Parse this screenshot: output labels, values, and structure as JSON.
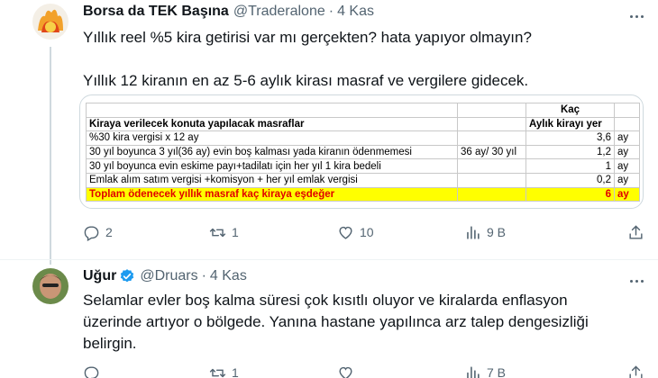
{
  "tweet1": {
    "display_name": "Borsa da TEK Başına",
    "handle": "@Traderalone",
    "dot": "·",
    "time": "4 Kas",
    "text_line1": "Yıllık reel %5 kira getirisi var mı gerçekten? hata yapıyor olmayın?",
    "text_line2": "Yıllık 12 kiranın en az 5-6 aylık kirası masraf ve vergilere gidecek.",
    "table": {
      "header_right_1": "Kaç",
      "header_left": "Kiraya verilecek konuta yapılacak masraflar",
      "header_right_2": "Aylık kirayı yer",
      "rows": [
        {
          "label": "%30 kira vergisi x 12 ay",
          "note": "",
          "value": "3,6",
          "unit": "ay"
        },
        {
          "label": "30 yıl boyunca 3 yıl(36 ay) evin boş kalması yada kiranın ödenmemesi",
          "note": "36 ay/ 30 yıl",
          "value": "1,2",
          "unit": "ay"
        },
        {
          "label": "30 yıl boyunca evin eskime payı+tadilatı için her yıl 1 kira bedeli",
          "note": "",
          "value": "1",
          "unit": "ay"
        },
        {
          "label": "Emlak alım satım vergisi +komisyon + her yıl emlak vergisi",
          "note": "",
          "value": "0,2",
          "unit": "ay"
        }
      ],
      "total": {
        "label": "Toplam ödenecek yıllık masraf kaç kiraya eşdeğer",
        "value": "6",
        "unit": "ay"
      }
    },
    "stats": {
      "replies": "2",
      "retweets": "1",
      "likes": "10",
      "views": "9 B"
    }
  },
  "tweet2": {
    "display_name": "Uğur",
    "handle": "@Druars",
    "dot": "·",
    "time": "4 Kas",
    "text_line1": "Selamlar evler boş kalma süresi çok kısıtlı oluyor ve kiralarda enflasyon",
    "text_line2": "üzerinde artıyor o bölgede. Yanına hastane yapılınca arz talep dengesizliği",
    "text_line3": "belirgin.",
    "stats": {
      "replies": "",
      "retweets": "1",
      "likes": "",
      "views": "7 B"
    }
  },
  "colors": {
    "text": "#0f1419",
    "secondary": "#536471",
    "verified": "#1d9bf0",
    "highlight": "#ffff00",
    "total_text": "#e00000"
  }
}
